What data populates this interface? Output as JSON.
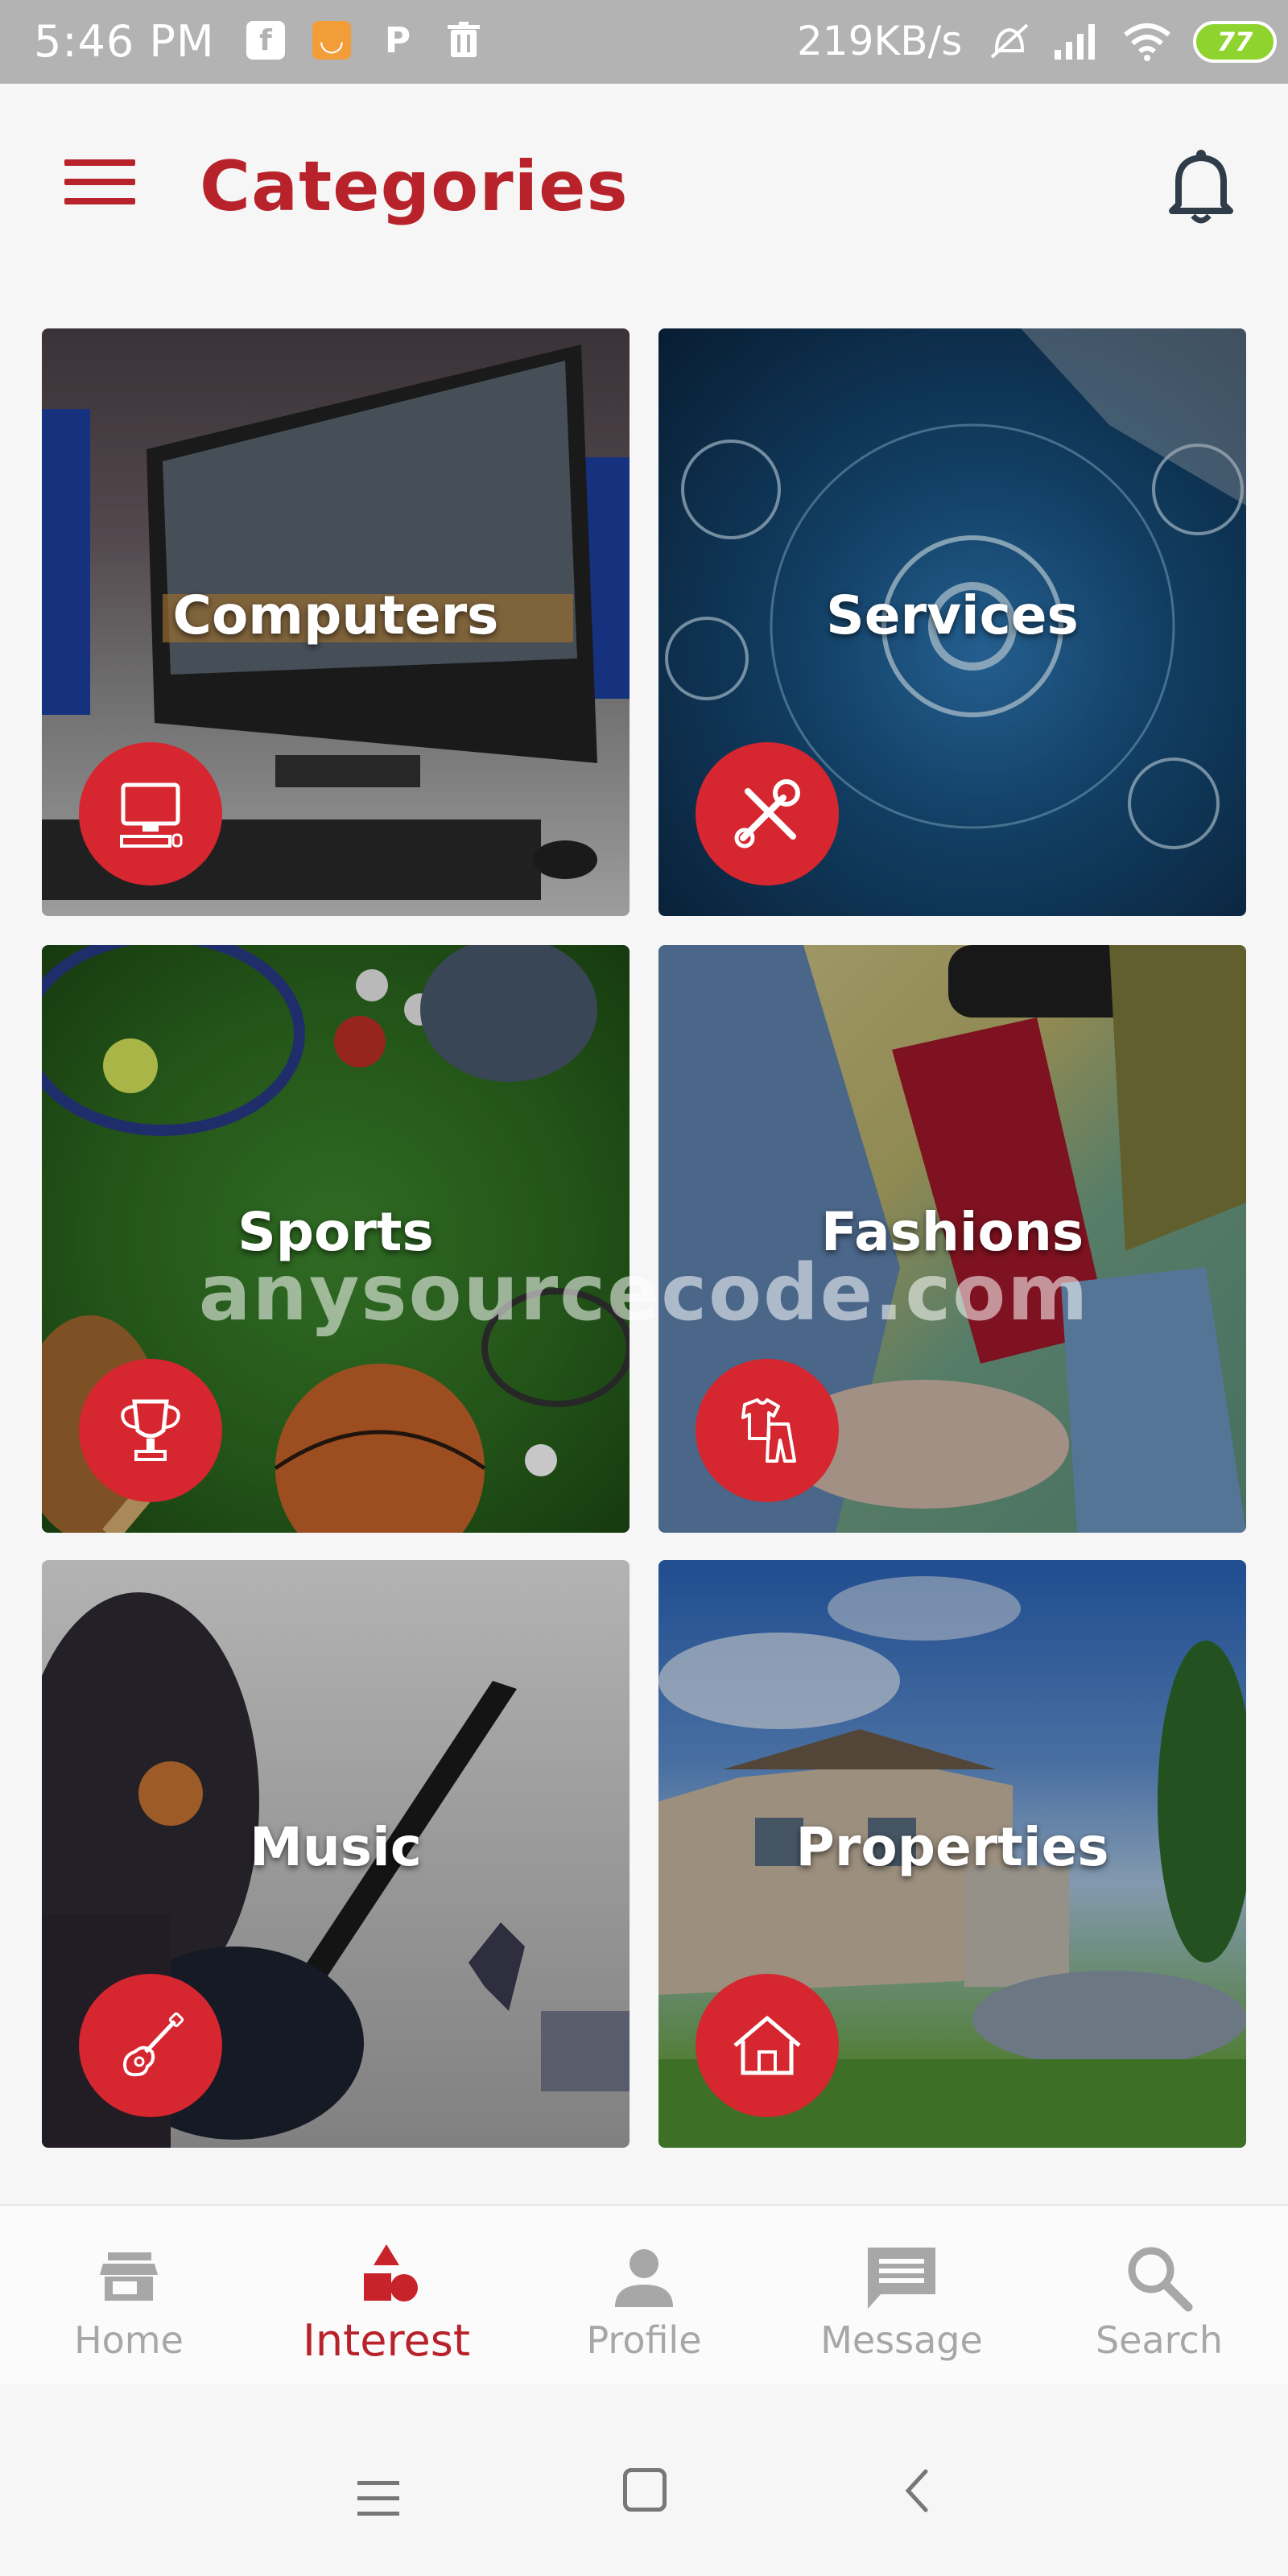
{
  "status_bar": {
    "time": "5:46 PM",
    "network_speed": "219KB/s",
    "battery": "77",
    "icons_left": [
      "facebook-icon",
      "ali-icon",
      "p-icon",
      "trash-icon"
    ],
    "icons_right": [
      "mute-icon",
      "signal-icon",
      "wifi-icon",
      "battery-icon"
    ]
  },
  "header": {
    "title": "Categories",
    "menu_icon": "hamburger-icon",
    "notification_icon": "bell-icon"
  },
  "categories": [
    {
      "label": "Computers",
      "icon": "monitor-icon"
    },
    {
      "label": "Services",
      "icon": "tools-icon"
    },
    {
      "label": "Sports",
      "icon": "trophy-icon"
    },
    {
      "label": "Fashions",
      "icon": "clothes-icon"
    },
    {
      "label": "Music",
      "icon": "guitar-icon"
    },
    {
      "label": "Properties",
      "icon": "house-icon"
    }
  ],
  "watermark": "anysourcecode.com",
  "bottom_nav": {
    "items": [
      {
        "label": "Home",
        "icon": "store-icon"
      },
      {
        "label": "Interest",
        "icon": "shapes-icon"
      },
      {
        "label": "Profile",
        "icon": "person-icon"
      },
      {
        "label": "Message",
        "icon": "message-icon"
      },
      {
        "label": "Search",
        "icon": "search-icon"
      }
    ],
    "active": "Interest"
  },
  "colors": {
    "accent": "#b8232b",
    "badge": "#d6262f",
    "inactive": "#a7a7a7"
  }
}
